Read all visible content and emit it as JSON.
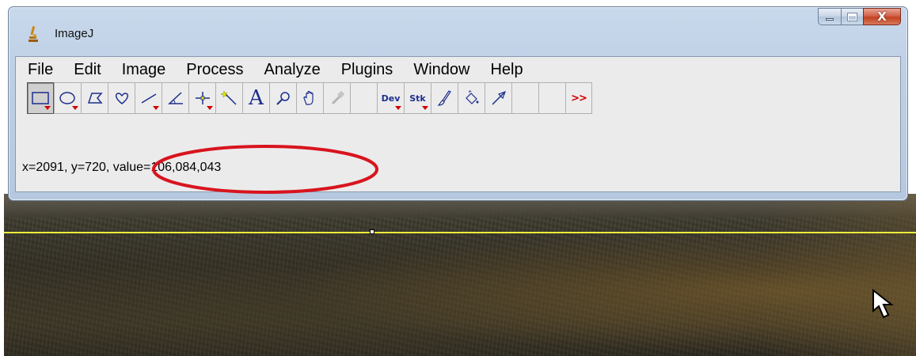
{
  "window": {
    "title": "ImageJ",
    "controls": {
      "minimize": "minimize",
      "maximize": "maximize",
      "close": "X"
    }
  },
  "menubar": {
    "items": [
      "File",
      "Edit",
      "Image",
      "Process",
      "Analyze",
      "Plugins",
      "Window",
      "Help"
    ]
  },
  "toolbar": {
    "tools": [
      {
        "name": "rectangle-tool",
        "icon": "rectangle-icon",
        "has_menu": true,
        "selected": true
      },
      {
        "name": "oval-tool",
        "icon": "oval-icon",
        "has_menu": true
      },
      {
        "name": "polygon-tool",
        "icon": "polygon-icon"
      },
      {
        "name": "freehand-tool",
        "icon": "heart-freehand-icon"
      },
      {
        "name": "line-tool",
        "icon": "line-icon",
        "has_menu": true
      },
      {
        "name": "angle-tool",
        "icon": "angle-icon"
      },
      {
        "name": "point-tool",
        "icon": "point-crosshair-icon",
        "has_menu": true
      },
      {
        "name": "wand-tool",
        "icon": "wand-icon"
      },
      {
        "name": "text-tool",
        "icon": "text-A-icon",
        "label": "A"
      },
      {
        "name": "magnifier-tool",
        "icon": "magnifier-icon"
      },
      {
        "name": "scroll-tool",
        "icon": "hand-icon"
      },
      {
        "name": "color-picker-tool",
        "icon": "dropper-icon",
        "disabled": true
      },
      {
        "name": "empty-slot-1",
        "icon": ""
      },
      {
        "name": "developer-menu",
        "icon": "dev-icon",
        "label": "Dev",
        "has_menu": true
      },
      {
        "name": "stacks-menu",
        "icon": "stk-icon",
        "label": "Stk",
        "has_menu": true
      },
      {
        "name": "brush-tool",
        "icon": "brush-icon"
      },
      {
        "name": "flood-fill-tool",
        "icon": "bucket-icon"
      },
      {
        "name": "arrow-tool",
        "icon": "arrow-icon"
      },
      {
        "name": "empty-slot-2",
        "icon": ""
      },
      {
        "name": "empty-slot-3",
        "icon": ""
      },
      {
        "name": "more-tools",
        "icon": "double-chevron-icon",
        "label": ">>"
      }
    ]
  },
  "status": {
    "text": "x=2091, y=720, value=106,084,043"
  },
  "colors": {
    "selection_line": "#ecec3a",
    "annotation_ellipse": "#d8141e",
    "menu_triangle": "#d40000"
  }
}
